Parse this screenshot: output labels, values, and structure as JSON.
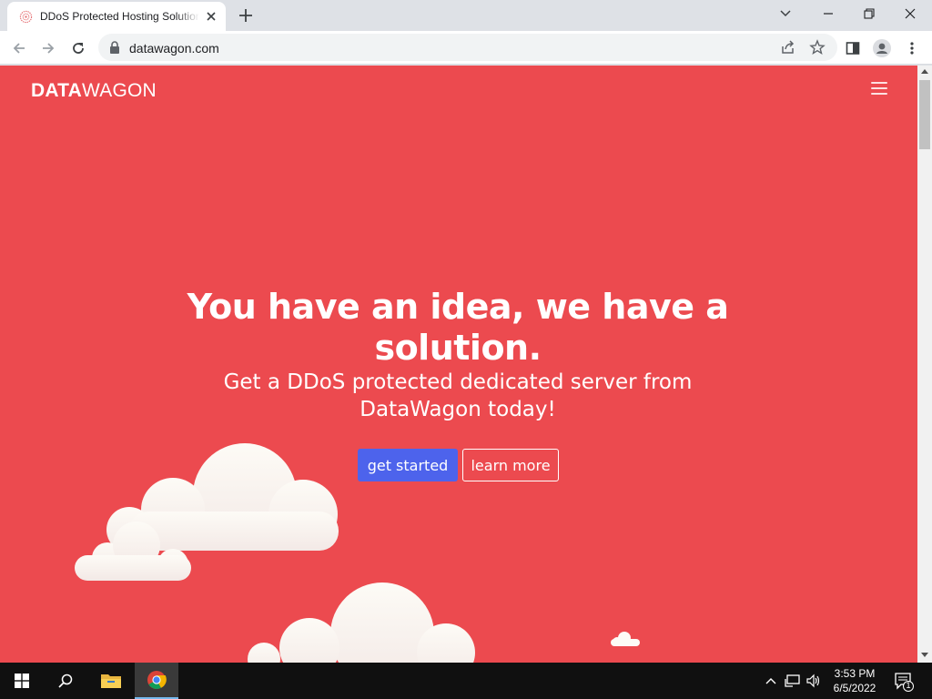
{
  "browser": {
    "tab_title": "DDoS Protected Hosting Solutions",
    "url": "datawagon.com"
  },
  "page": {
    "brand_bold": "DATA",
    "brand_light": "WAGON",
    "headline": "You have an idea, we have a solution.",
    "subheadline": "Get a DDoS protected dedicated server from DataWagon today!",
    "primary_cta": "get started",
    "secondary_cta": "learn more",
    "colors": {
      "hero_background": "#ec4a4f",
      "primary_button": "#4d63ec",
      "cloud": "#fbf8f3"
    }
  },
  "taskbar": {
    "time": "3:53 PM",
    "date": "6/5/2022",
    "notification_count": "1"
  },
  "icons": [
    "windows-start-icon",
    "search-icon",
    "file-explorer-icon",
    "chrome-icon",
    "chevron-up-icon",
    "network-icon",
    "volume-icon",
    "notification-icon",
    "lock-icon",
    "share-icon",
    "star-icon",
    "side-panel-icon",
    "profile-icon",
    "kebab-menu-icon",
    "hamburger-menu-icon"
  ]
}
